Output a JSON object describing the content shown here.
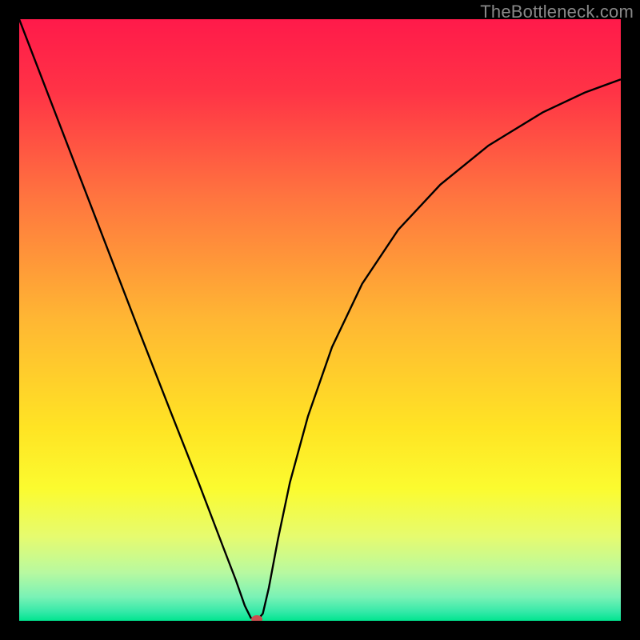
{
  "watermark": "TheBottleneck.com",
  "chart_data": {
    "type": "line",
    "title": "",
    "xlabel": "",
    "ylabel": "",
    "xlim": [
      0,
      1
    ],
    "ylim": [
      0,
      1
    ],
    "background_gradient": {
      "type": "vertical",
      "stops": [
        {
          "offset": 0.0,
          "color": "#ff1a4a"
        },
        {
          "offset": 0.12,
          "color": "#ff3346"
        },
        {
          "offset": 0.3,
          "color": "#ff763f"
        },
        {
          "offset": 0.5,
          "color": "#ffb733"
        },
        {
          "offset": 0.68,
          "color": "#ffe424"
        },
        {
          "offset": 0.78,
          "color": "#fbfb2f"
        },
        {
          "offset": 0.86,
          "color": "#e6fb6f"
        },
        {
          "offset": 0.92,
          "color": "#b8f9a0"
        },
        {
          "offset": 0.96,
          "color": "#7af2b6"
        },
        {
          "offset": 0.985,
          "color": "#34e9a8"
        },
        {
          "offset": 1.0,
          "color": "#00e58f"
        }
      ]
    },
    "series": [
      {
        "name": "curve",
        "type": "line",
        "color": "#000000",
        "x": [
          0.0,
          0.05,
          0.1,
          0.15,
          0.2,
          0.25,
          0.3,
          0.34,
          0.36,
          0.375,
          0.385,
          0.395,
          0.405,
          0.415,
          0.43,
          0.45,
          0.48,
          0.52,
          0.57,
          0.63,
          0.7,
          0.78,
          0.87,
          0.94,
          1.0
        ],
        "y": [
          1.0,
          0.87,
          0.74,
          0.61,
          0.48,
          0.352,
          0.225,
          0.12,
          0.068,
          0.025,
          0.005,
          0.0,
          0.012,
          0.055,
          0.135,
          0.23,
          0.34,
          0.455,
          0.56,
          0.65,
          0.725,
          0.79,
          0.845,
          0.878,
          0.9
        ]
      }
    ],
    "marker": {
      "x": 0.395,
      "y": 0.0,
      "color": "#c94f4f",
      "rx": 7,
      "ry": 5
    }
  }
}
